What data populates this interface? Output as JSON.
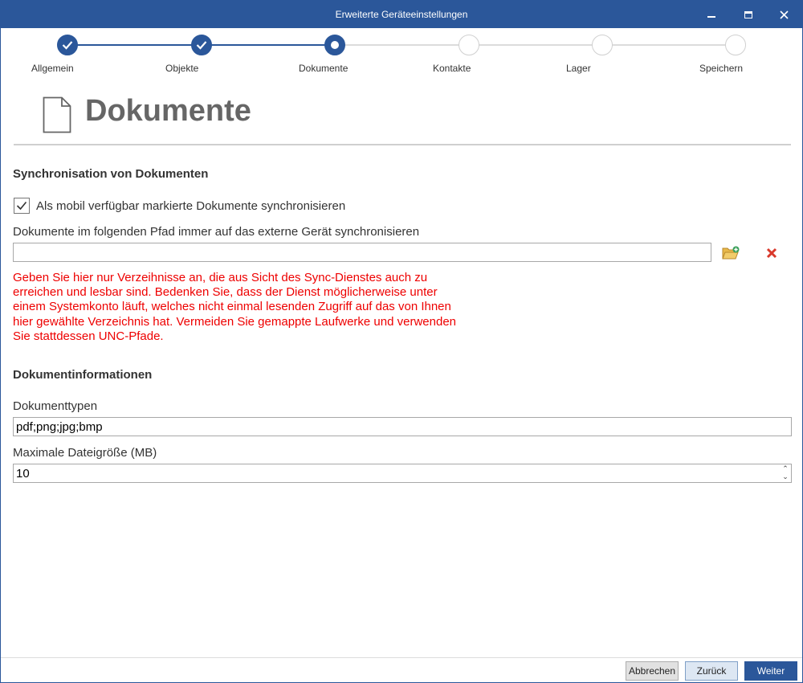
{
  "window": {
    "title": "Erweiterte Geräteeinstellungen"
  },
  "stepper": {
    "steps": [
      {
        "label": "Allgemein",
        "state": "done"
      },
      {
        "label": "Objekte",
        "state": "done"
      },
      {
        "label": "Dokumente",
        "state": "current"
      },
      {
        "label": "Kontakte",
        "state": "todo"
      },
      {
        "label": "Lager",
        "state": "todo"
      },
      {
        "label": "Speichern",
        "state": "todo"
      }
    ]
  },
  "page": {
    "title": "Dokumente",
    "icon": "document-icon"
  },
  "sync": {
    "section_title": "Synchronisation von Dokumenten",
    "checkbox_label": "Als mobil verfügbar markierte Dokumente synchronisieren",
    "checkbox_checked": true,
    "path_label": "Dokumente im folgenden Pfad immer auf das externe Gerät synchronisieren",
    "path_value": "",
    "browse_icon": "folder-add-icon",
    "clear_icon": "delete-x-icon",
    "warning_lines": [
      "Geben Sie hier nur Verzeihnisse an, die aus Sicht des Sync-Dienstes auch zu",
      "erreichen und lesbar sind. Bedenken Sie, dass der Dienst möglicherweise unter",
      "einem Systemkonto läuft, welches nicht einmal lesenden Zugriff auf das von Ihnen",
      "hier gewählte Verzeichnis hat. Vermeiden Sie gemappte Laufwerke und verwenden",
      "Sie stattdessen UNC-Pfade."
    ]
  },
  "info": {
    "section_title": "Dokumentinformationen",
    "types_label": "Dokumenttypen",
    "types_value": "pdf;png;jpg;bmp",
    "maxsize_label": "Maximale Dateigröße (MB)",
    "maxsize_value": "10"
  },
  "footer": {
    "cancel_label": "Abbrechen",
    "back_label": "Zurück",
    "next_label": "Weiter"
  },
  "colors": {
    "accent": "#2b579a",
    "warning": "#ee0000",
    "delete": "#d9392b",
    "folder": "#e8b84a",
    "folder_plus": "#3aa05a"
  }
}
